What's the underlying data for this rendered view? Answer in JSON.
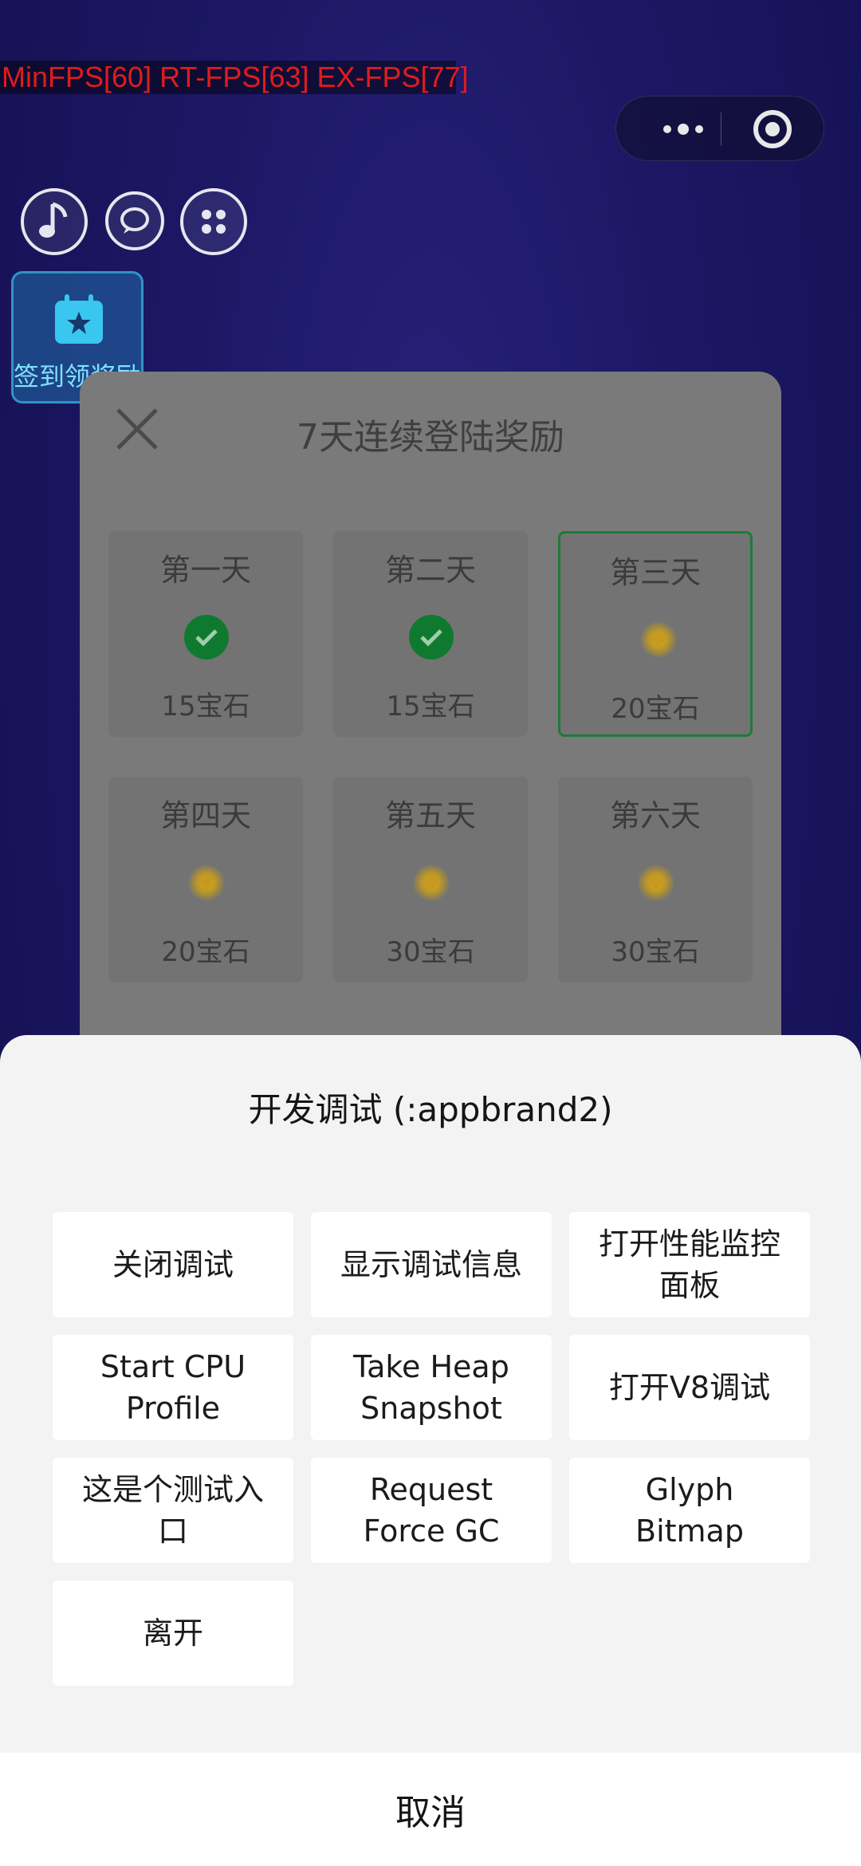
{
  "overlay": {
    "fps_text": "MinFPS[60] RT-FPS[63] EX-FPS[77]"
  },
  "capsule": {
    "more_icon": "more-dots-icon",
    "close_icon": "target-close-icon"
  },
  "game": {
    "top_buttons": [
      {
        "icon": "music-note-icon"
      },
      {
        "icon": "chat-bubble-icon"
      },
      {
        "icon": "grid-dots-icon"
      }
    ],
    "signin_label": "签到领奖励"
  },
  "reward_dialog": {
    "title": "7天连续登陆奖励",
    "days": [
      {
        "name": "第一天",
        "reward": "15宝石",
        "claimed": true
      },
      {
        "name": "第二天",
        "reward": "15宝石",
        "claimed": true
      },
      {
        "name": "第三天",
        "reward": "20宝石",
        "claimed": false,
        "selected": true
      },
      {
        "name": "第四天",
        "reward": "20宝石",
        "claimed": false
      },
      {
        "name": "第五天",
        "reward": "30宝石",
        "claimed": false
      },
      {
        "name": "第六天",
        "reward": "30宝石",
        "claimed": false
      }
    ]
  },
  "action_sheet": {
    "title": "开发调试 (:appbrand2)",
    "options": [
      {
        "lines": [
          "关闭调试"
        ]
      },
      {
        "lines": [
          "显示调试信息"
        ]
      },
      {
        "lines": [
          "打开性能监控",
          "面板"
        ]
      },
      {
        "lines": [
          "Start CPU",
          "Profile"
        ]
      },
      {
        "lines": [
          "Take Heap",
          "Snapshot"
        ]
      },
      {
        "lines": [
          "打开V8调试"
        ]
      },
      {
        "lines": [
          "这是个测试入",
          "口"
        ]
      },
      {
        "lines": [
          "Request",
          "Force GC"
        ]
      },
      {
        "lines": [
          "Glyph",
          "Bitmap"
        ]
      },
      {
        "lines": [
          "离开"
        ]
      }
    ],
    "cancel_label": "取消"
  },
  "colors": {
    "background": "#1b1762",
    "fps_text": "#e01c1c",
    "claimed_check": "#0f7a2f",
    "selected_border": "#1f7a3c",
    "sheet_bg": "#f3f3f3"
  }
}
